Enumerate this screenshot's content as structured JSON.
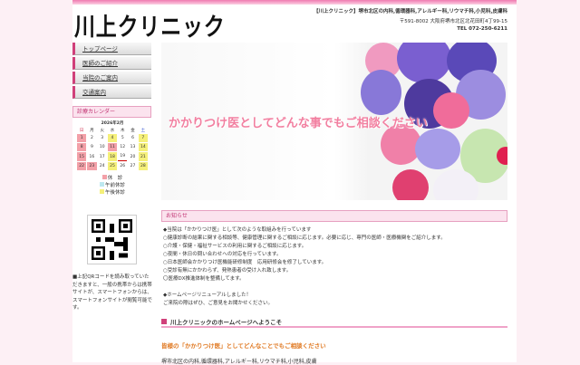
{
  "header": {
    "logo": "川上クリニック",
    "tagline": "【川上クリニック】堺市北区の内科,循環器科,アレルギー科,リウマチ科,小児科,皮膚科",
    "address": "〒591-8002 大阪府堺市北区北花田町4丁99-15",
    "tel": "TEL 072-250-6211"
  },
  "nav": [
    "トップページ",
    "医師のご紹介",
    "当院のご案内",
    "交通案内"
  ],
  "calendar": {
    "title": "診療カレンダー",
    "month": "2026年2月",
    "weekdays": [
      "日",
      "月",
      "火",
      "水",
      "木",
      "金",
      "土"
    ],
    "weeks": [
      [
        1,
        2,
        3,
        4,
        5,
        6,
        7
      ],
      [
        8,
        9,
        10,
        11,
        12,
        13,
        14
      ],
      [
        15,
        16,
        17,
        18,
        19,
        20,
        21
      ],
      [
        22,
        23,
        24,
        25,
        26,
        27,
        28
      ]
    ],
    "closed": [
      1,
      8,
      11,
      15,
      22,
      23
    ],
    "pm_closed": [
      4,
      7,
      14,
      18,
      21,
      25,
      28
    ],
    "today": 19,
    "legend": [
      "休　診",
      "午前休診",
      "午後休診"
    ],
    "colors": {
      "closed": "#f3a0a8",
      "am": "#bde8f0",
      "pm": "#f5f07a"
    }
  },
  "qr_text": "■上記QRコードを読み取っていただきますと、一般の携帯からは携帯サイトが、スマートフォンからは、スマートフォンサイトが閲覧可能です。",
  "hero": {
    "catch": "かかりつけ医としてどんな事でもご相談ください"
  },
  "news": {
    "title": "お知らせ",
    "lines": [
      "◆当院は「かかりつけ医」として次のような取組みを行っています",
      "○健康診断の結果に関する相談等、健康管理に関するご相談に応じます。必要に応じ、専門の医師・医療機関をご紹介します。",
      "○介護・保健・福祉サービスの利用に関するご相談に応じます。",
      "○夜間・休日の問い合わせへの対応を行っています。",
      "○日本医師会かかりつけ医機能研修制度　応用研修会を修了しています。",
      "○受診有無にかかわらず、発熱患者の受け入れ致します。",
      "〇医療DX推進体制を整備してます。",
      "",
      "◆ホームページリニューアルしました！",
      "ご来院の際はぜひ、ご意見をお聞かせください。"
    ]
  },
  "welcome": {
    "title": "川上クリニックのホームページへようこそ",
    "subtitle": "皆様の「かかりつけ医」としてどんなことでもご相談ください",
    "desc": "堺市北区の内科,循環器科,アレルギー科,リウマチ科,小児科,皮膚"
  }
}
